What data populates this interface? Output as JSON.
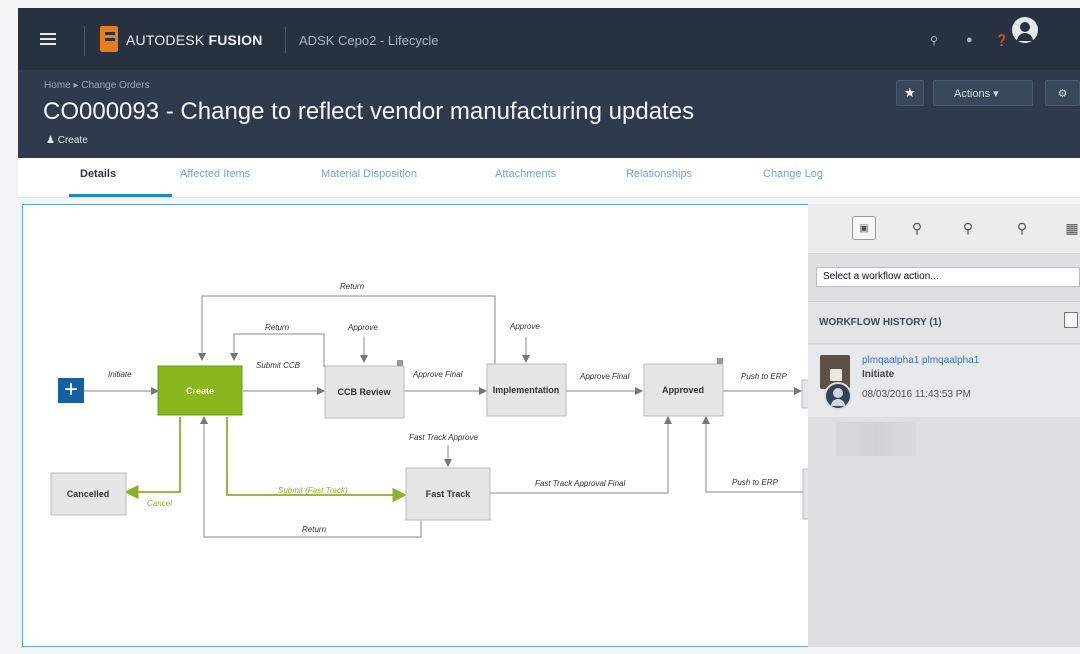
{
  "topbar": {
    "brand_light": "AUTODESK",
    "brand_bold": "FUSION",
    "workspace": "ADSK Cepo2 - Lifecycle"
  },
  "header": {
    "breadcrumb": "Home ▸ Change Orders",
    "title": "CO000093 - Change to reflect vendor manufacturing updates",
    "state": "Create",
    "actions_label": "Actions"
  },
  "tabs": [
    "Details",
    "Affected Items",
    "Material Disposition",
    "Attachments",
    "Relationships",
    "Change Log"
  ],
  "workflow": {
    "states": {
      "create": "Create",
      "ccb_review": "CCB Review",
      "implementation": "Implementation",
      "approved": "Approved",
      "cancelled": "Cancelled",
      "fast_track": "Fast Track"
    },
    "transitions": {
      "initiate": "Initiate",
      "return_top": "Return",
      "return_mid": "Return",
      "approve_ccb": "Approve",
      "approve_impl": "Approve",
      "submit_ccb": "Submit CCB",
      "approve_final_1": "Approve Final",
      "approve_final_2": "Approve Final",
      "push_erp_1": "Push to ERP",
      "fast_track_approve": "Fast Track Approve",
      "submit_fast": "Submit (Fast Track)",
      "fast_final": "Fast Track Approval Final",
      "push_erp_2": "Push to ERP",
      "cancel": "Cancel",
      "return_bottom": "Return"
    }
  },
  "sidebar": {
    "workflow_action_placeholder": "Select a workflow action...",
    "history_title": "WORKFLOW HISTORY (1)",
    "entry": {
      "user": "plmqaalpha1 plmqaalpha1",
      "action": "Initiate",
      "time": "08/03/2016 11:43:53 PM"
    }
  }
}
